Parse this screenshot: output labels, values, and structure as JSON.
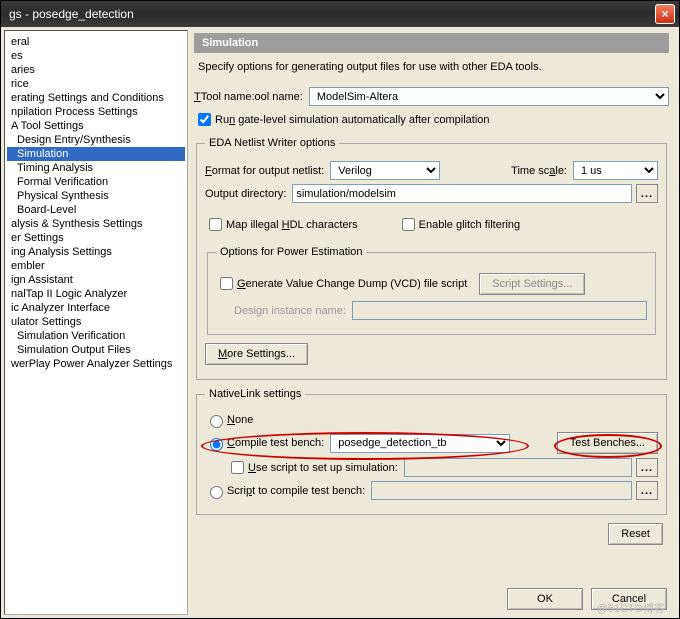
{
  "window": {
    "title": "gs - posedge_detection"
  },
  "tree": [
    {
      "label": "eral",
      "lvl": 0
    },
    {
      "label": "es",
      "lvl": 0
    },
    {
      "label": "aries",
      "lvl": 0
    },
    {
      "label": "rice",
      "lvl": 0
    },
    {
      "label": "erating Settings and Conditions",
      "lvl": 0
    },
    {
      "label": "npilation Process Settings",
      "lvl": 0
    },
    {
      "label": "A Tool Settings",
      "lvl": 0
    },
    {
      "label": "Design Entry/Synthesis",
      "lvl": 1
    },
    {
      "label": "Simulation",
      "lvl": 1,
      "sel": true
    },
    {
      "label": "Timing Analysis",
      "lvl": 1
    },
    {
      "label": "Formal Verification",
      "lvl": 1
    },
    {
      "label": "Physical Synthesis",
      "lvl": 1
    },
    {
      "label": "Board-Level",
      "lvl": 1
    },
    {
      "label": "alysis & Synthesis Settings",
      "lvl": 0
    },
    {
      "label": "er Settings",
      "lvl": 0
    },
    {
      "label": "ing Analysis Settings",
      "lvl": 0
    },
    {
      "label": "embler",
      "lvl": 0
    },
    {
      "label": "ign Assistant",
      "lvl": 0
    },
    {
      "label": "nalTap II Logic Analyzer",
      "lvl": 0
    },
    {
      "label": "ic Analyzer Interface",
      "lvl": 0
    },
    {
      "label": "ulator Settings",
      "lvl": 0
    },
    {
      "label": "Simulation Verification",
      "lvl": 1
    },
    {
      "label": "Simulation Output Files",
      "lvl": 1
    },
    {
      "label": "werPlay Power Analyzer Settings",
      "lvl": 0
    }
  ],
  "sim": {
    "header": "Simulation",
    "desc": "Specify options for generating output files for use with other EDA tools.",
    "tool_label": "Tool name:",
    "tool_value": "ModelSim-Altera",
    "run_gate": "Run gate-level simulation automatically after compilation",
    "netlist": {
      "legend": "EDA Netlist Writer options",
      "format_label": "Format for output netlist:",
      "format_value": "Verilog",
      "timescale_label": "Time scale:",
      "timescale_value": "1 us",
      "outdir_label": "Output directory:",
      "outdir_value": "simulation/modelsim",
      "map_hdl": "Map illegal HDL characters",
      "glitch": "Enable glitch filtering",
      "power_legend": "Options for Power Estimation",
      "vcd": "Generate Value Change Dump (VCD) file script",
      "script_settings": "Script Settings...",
      "design_inst": "Design instance name:",
      "more": "More Settings..."
    },
    "native": {
      "legend": "NativeLink settings",
      "none": "None",
      "compile": "Compile test bench:",
      "compile_value": "posedge_detection_tb",
      "test_benches": "Test Benches...",
      "use_script": "Use script to set up simulation:",
      "script_compile": "Script to compile test bench:"
    },
    "reset": "Reset",
    "ok": "OK",
    "cancel": "Cancel"
  },
  "watermark": "@51CTO博客"
}
